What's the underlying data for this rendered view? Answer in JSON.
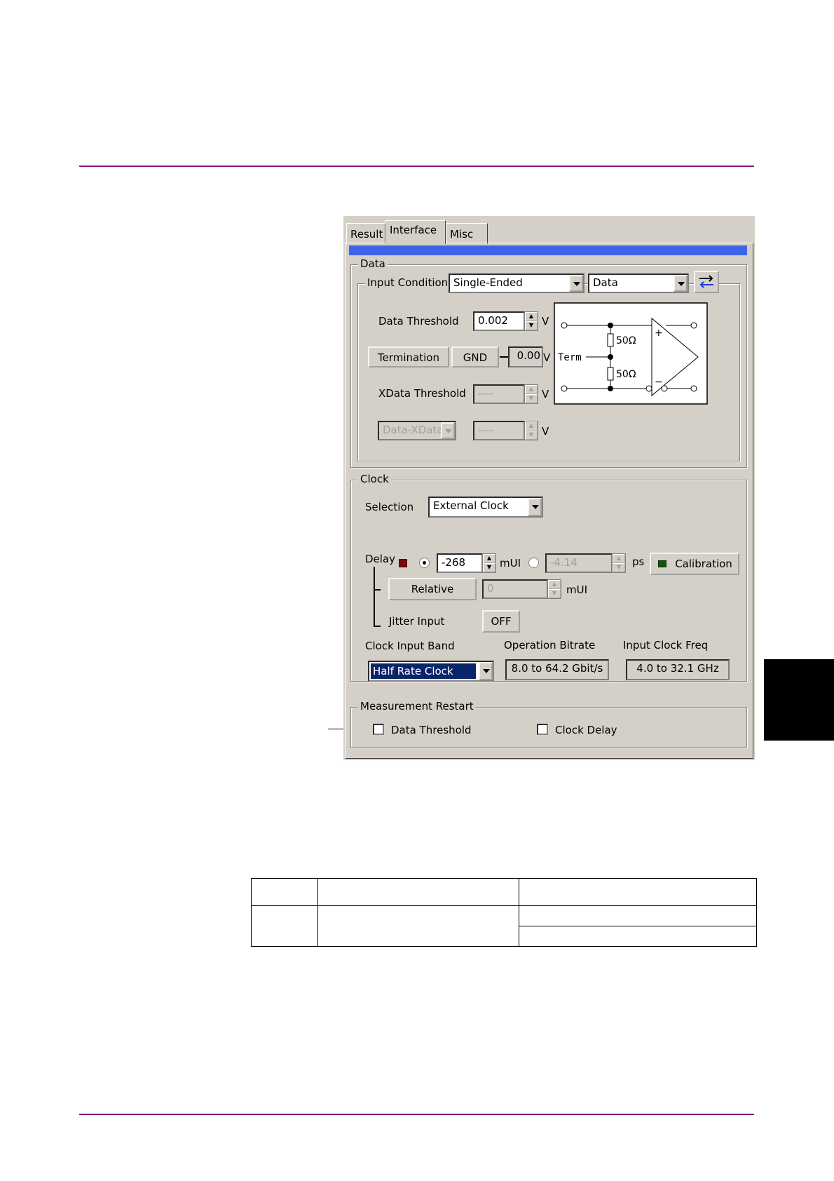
{
  "tabs": [
    "Result",
    "Interface",
    "Misc"
  ],
  "data_group": {
    "title": "Data",
    "input_condition_label": "Input Condition",
    "input_condition_value": "Single-Ended",
    "data_select_value": "Data",
    "data_threshold_label": "Data Threshold",
    "data_threshold_value": "0.002",
    "unit_v": "V",
    "termination_button": "Termination",
    "gnd_button": "GND",
    "termination_value": "0.00",
    "xdata_threshold_label": "XData Threshold",
    "xdata_threshold_value": "----",
    "data_xdata_value": "Data-XData",
    "data_xdata_threshold_value": "----",
    "schematic": {
      "term_label": "Term",
      "r1": "50Ω",
      "r2": "50Ω",
      "plus": "+",
      "minus": "−"
    }
  },
  "clock_group": {
    "title": "Clock",
    "selection_label": "Selection",
    "selection_value": "External Clock",
    "delay_label": "Delay",
    "delay_mui_value": "-268",
    "unit_mui": "mUI",
    "delay_ps_value": "-4.14",
    "unit_ps": "ps",
    "calibration_button": "Calibration",
    "relative_button": "Relative",
    "relative_value": "0",
    "relative_unit": "mUI",
    "jitter_input_label": "Jitter Input",
    "jitter_input_button": "OFF",
    "clock_input_band_label": "Clock Input Band",
    "clock_input_band_value": "Half Rate Clock",
    "operation_bitrate_label": "Operation Bitrate",
    "operation_bitrate_value": "8.0 to 64.2 Gbit/s",
    "input_clock_freq_label": "Input Clock Freq",
    "input_clock_freq_value": "4.0 to 32.1 GHz",
    "delay_led_color": "#7a0a0a",
    "calibration_led_color": "#0a5a0a"
  },
  "restart_group": {
    "title": "Measurement Restart",
    "data_threshold_label": "Data Threshold",
    "clock_delay_label": "Clock Delay"
  },
  "colors": {
    "rule": "#8a1a7a",
    "selection_bar": "#3d64e6",
    "selected_item_bg": "#0a246a"
  }
}
